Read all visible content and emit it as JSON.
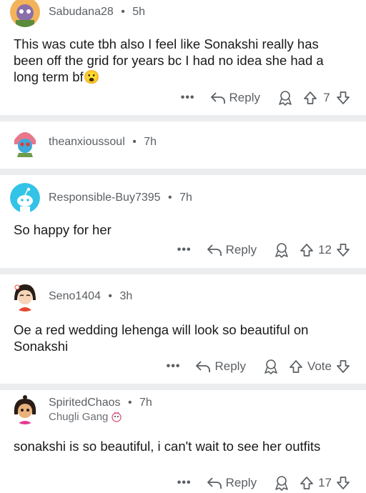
{
  "comments": [
    {
      "username": "Sabudana28",
      "time": "5h",
      "text": "This was cute tbh also I feel like Sonakshi really has been off the grid for years bc I had no idea she had a long term bf",
      "emoji": "😮",
      "more": "•••",
      "reply_label": "Reply",
      "score": "7"
    },
    {
      "username": "theanxioussoul",
      "time": "7h"
    },
    {
      "username": "Responsible-Buy7395",
      "time": "7h",
      "text": "So happy for her",
      "more": "•••",
      "reply_label": "Reply",
      "score": "12"
    },
    {
      "username": "Seno1404",
      "time": "3h",
      "text": "Oe a red wedding lehenga will look so beautiful on Sonakshi",
      "more": "•••",
      "reply_label": "Reply",
      "score": "Vote"
    },
    {
      "username": "SpiritedChaos",
      "time": "7h",
      "flair": "Chugli Gang",
      "text": "sonakshi is so beautiful, i can't wait to see her outfits",
      "more": "•••",
      "reply_label": "Reply",
      "score": "17"
    }
  ],
  "separator": "•",
  "colors": {
    "divider": "#ecedef",
    "meta": "#5b5f63",
    "text": "#1a1a1b",
    "snoo_bg": "#33c3e6"
  }
}
